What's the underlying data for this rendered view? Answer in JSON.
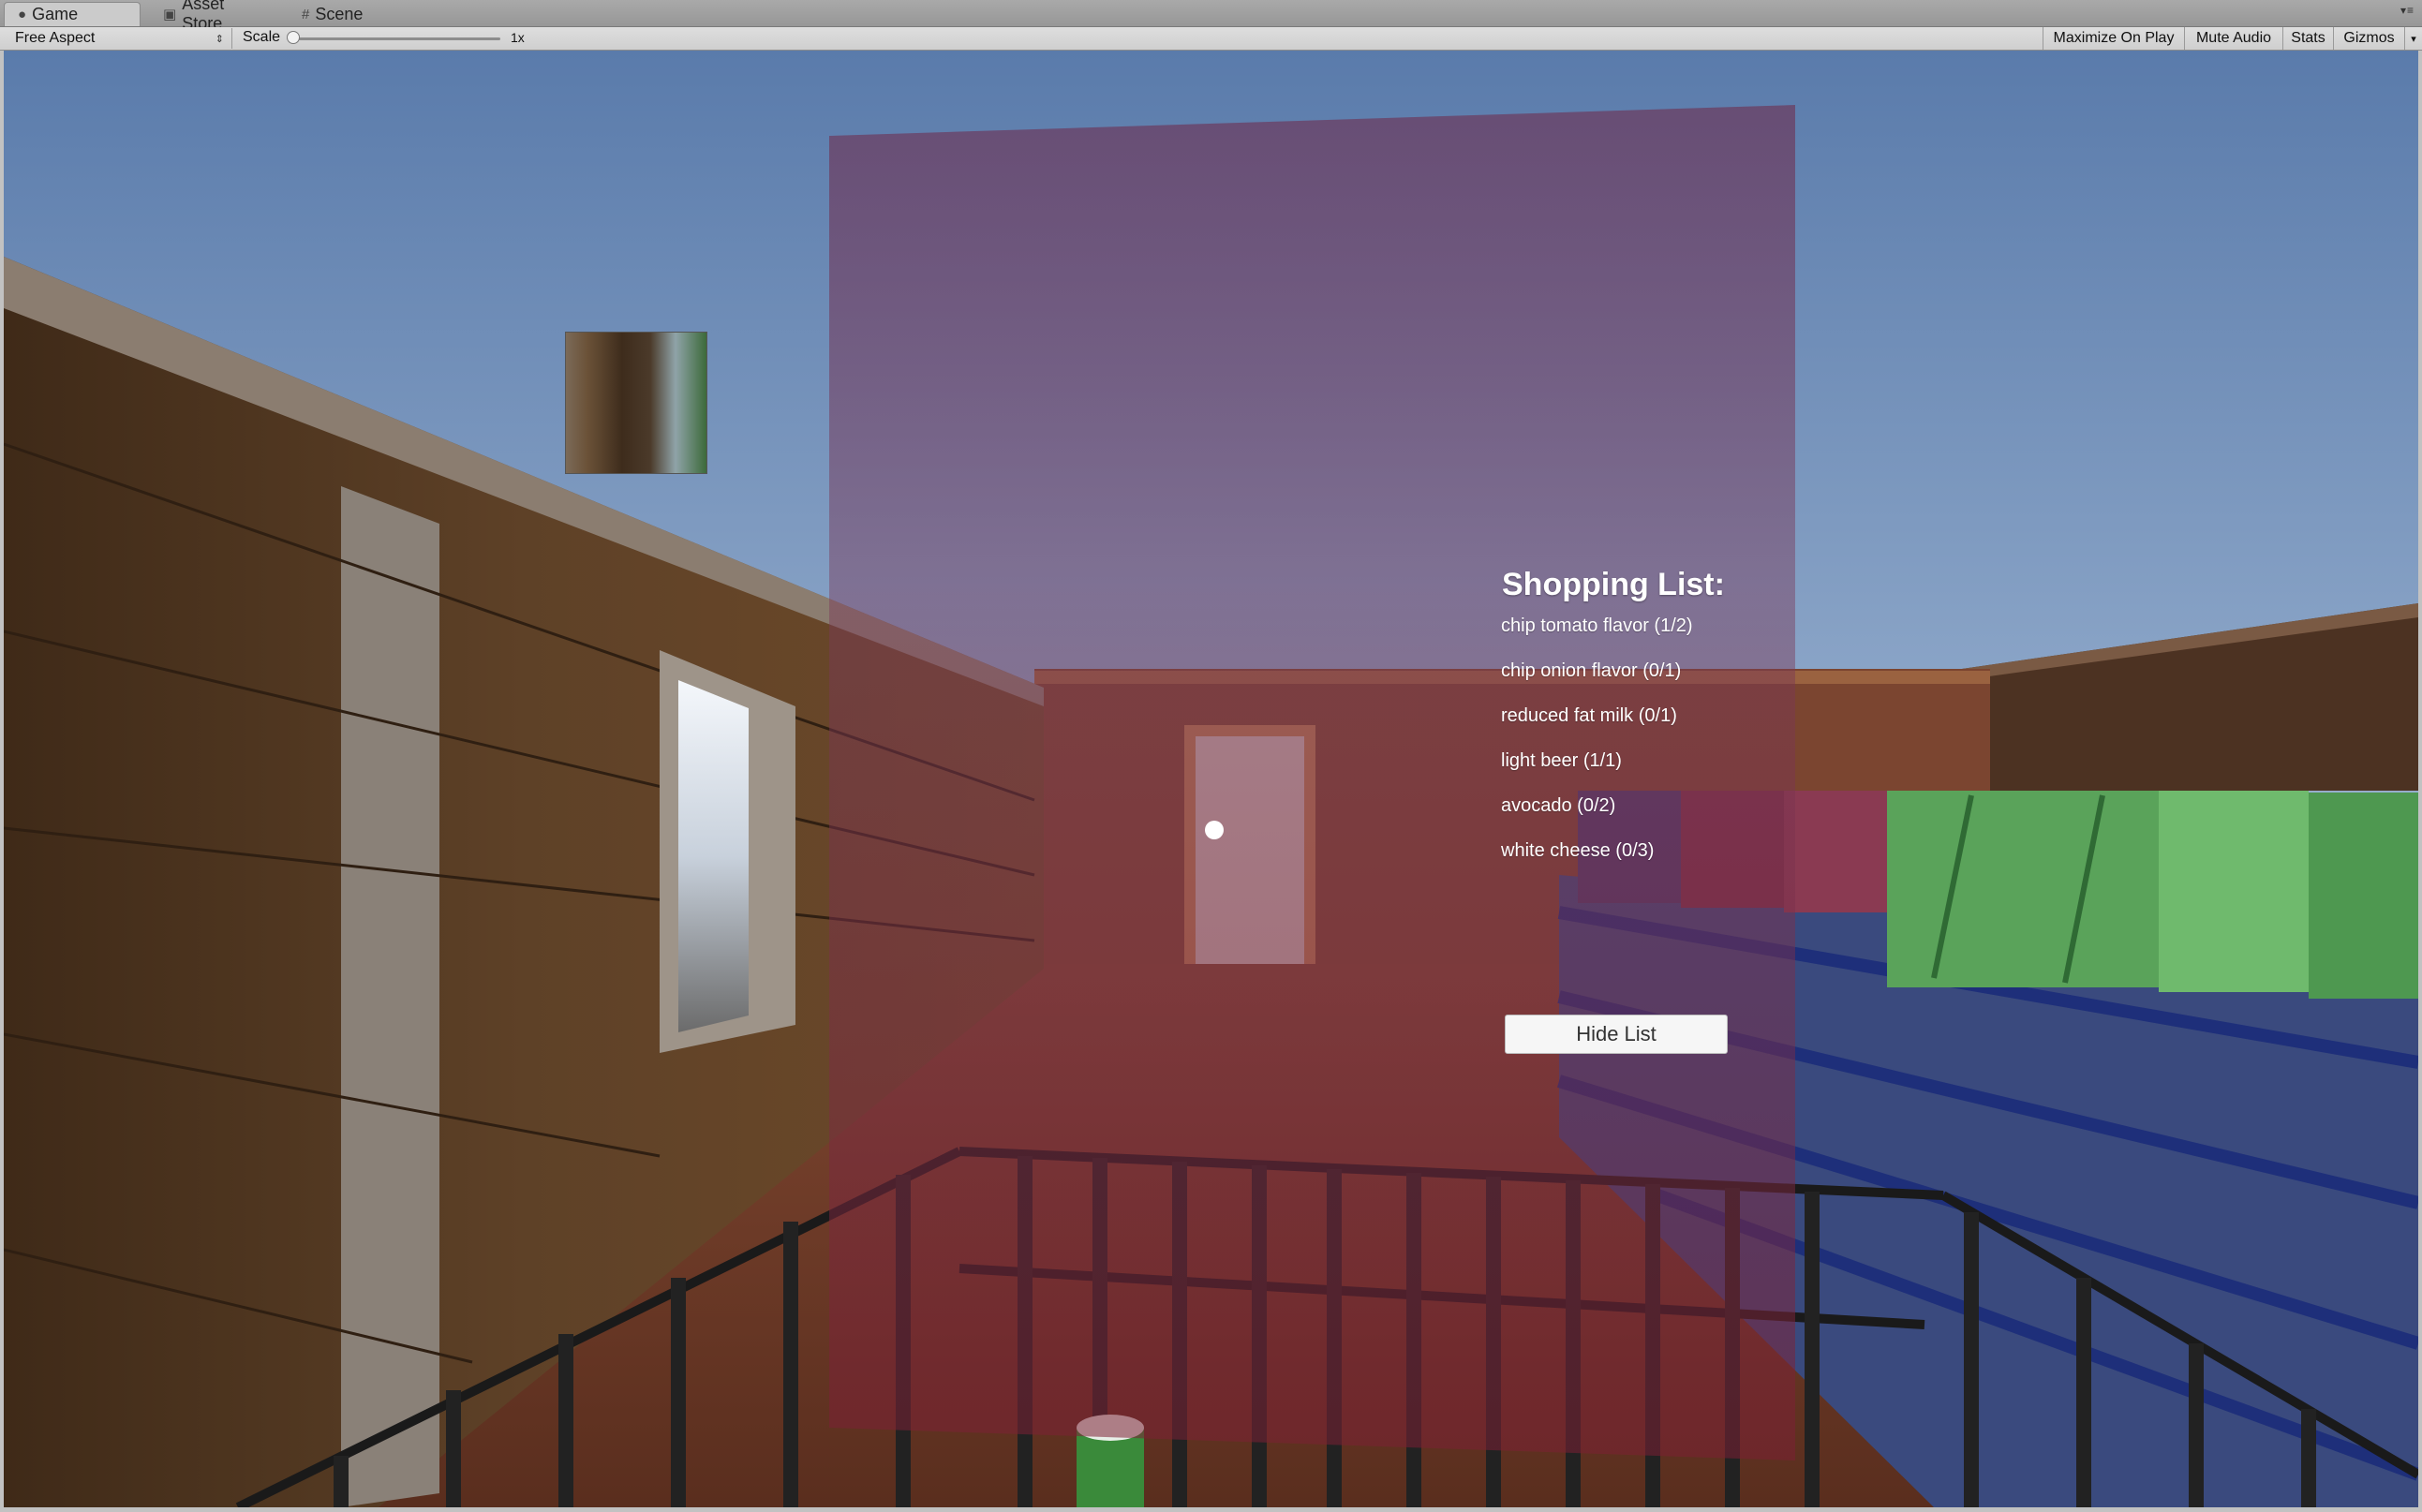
{
  "editor": {
    "tabs": [
      {
        "label": "Game",
        "icon": "game-controller-icon",
        "active": true
      },
      {
        "label": "Asset Store",
        "icon": "shopping-bag-icon",
        "active": false
      },
      {
        "label": "Scene",
        "icon": "grid-icon",
        "active": false
      }
    ],
    "toolbar": {
      "aspect": "Free Aspect",
      "scale_label": "Scale",
      "scale_value": "1x",
      "buttons": [
        "Maximize On Play",
        "Mute Audio",
        "Stats",
        "Gizmos"
      ]
    }
  },
  "game": {
    "shopping_list": {
      "title": "Shopping List:",
      "items": [
        "chip tomato flavor (1/2)",
        "chip onion flavor (0/1)",
        "reduced fat milk (0/1)",
        "light beer (1/1)",
        "avocado (0/2)",
        "white cheese (0/3)"
      ],
      "hide_button": "Hide List"
    },
    "colors": {
      "sky_top": "#5a7fae",
      "sky_bottom": "#d9e3ef",
      "wood_wall": "#5b3e24",
      "floor": "#8a4a30",
      "panel_overlay": "#7a1e3a",
      "shelf_blue": "#2d3f8c",
      "shelf_green": "#5aa35a"
    }
  }
}
